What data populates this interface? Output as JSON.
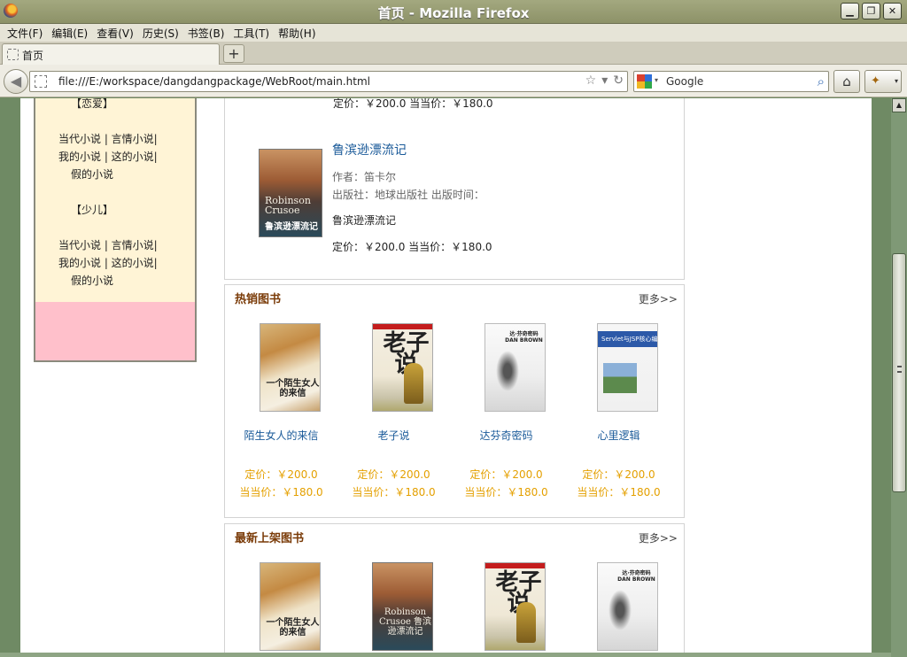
{
  "window": {
    "title": "首页 - Mozilla Firefox",
    "min_glyph": "▁",
    "max_glyph": "❐",
    "close_glyph": "✕"
  },
  "menu": [
    "文件(F)",
    "编辑(E)",
    "查看(V)",
    "历史(S)",
    "书签(B)",
    "工具(T)",
    "帮助(H)"
  ],
  "tab": {
    "label": "首页",
    "new_tab_glyph": "+"
  },
  "nav": {
    "url": "file:///E:/workspace/dangdangpackage/WebRoot/main.html",
    "search_placeholder": "Google",
    "back_glyph": "◀",
    "home_glyph": "⌂",
    "star_glyph": "☆",
    "dropdown_glyph": "▾",
    "reload_glyph": "↻",
    "search_glyph": "⌕"
  },
  "sidebar": {
    "cat1_title": "【恋爱】",
    "cat1_lines": [
      "当代小说 | 言情小说|",
      "我的小说 | 这的小说|",
      "假的小说"
    ],
    "cat2_title": "【少儿】",
    "cat2_lines": [
      "当代小说 | 言情小说|",
      "我的小说 | 这的小说|",
      "假的小说"
    ]
  },
  "top_panel": {
    "prev_price": "定价：￥200.0  当当价：￥180.0",
    "book": {
      "title": "鲁滨逊漂流记",
      "author": "作者：笛卡尔",
      "publisher": "出版社：地球出版社    出版时间：",
      "desc": "鲁滨逊漂流记",
      "price": "定价：￥200.0  当当价：￥180.0",
      "cover_en": "Robinson Crusoe",
      "cover_cn": "鲁滨逊漂流记"
    }
  },
  "hot": {
    "title": "热销图书",
    "more": "更多>>",
    "books": [
      {
        "name": "陌生女人的来信",
        "price": "定价：￥200.0",
        "dd_price": "当当价：￥180.0",
        "cover": "letter",
        "cover_text": "一个陌生女人的来信"
      },
      {
        "name": "老子说",
        "price": "定价：￥200.0",
        "dd_price": "当当价：￥180.0",
        "cover": "laozi",
        "cover_text": "老子说"
      },
      {
        "name": "达芬奇密码",
        "price": "定价：￥200.0",
        "dd_price": "当当价：￥180.0",
        "cover": "davinci",
        "cover_text": "达·芬奇密码 DAN BROWN"
      },
      {
        "name": "心里逻辑",
        "price": "定价：￥200.0",
        "dd_price": "当当价：￥180.0",
        "cover": "servlet",
        "cover_text": "Servlet与JSP核心编程"
      }
    ]
  },
  "newest": {
    "title": "最新上架图书",
    "more": "更多>>",
    "books": [
      {
        "cover": "letter",
        "cover_text": "一个陌生女人的来信"
      },
      {
        "cover": "robinson",
        "cover_text": "Robinson Crusoe 鲁滨逊漂流记"
      },
      {
        "cover": "laozi",
        "cover_text": "老子说"
      },
      {
        "cover": "davinci",
        "cover_text": "达·芬奇密码 DAN BROWN"
      }
    ]
  }
}
